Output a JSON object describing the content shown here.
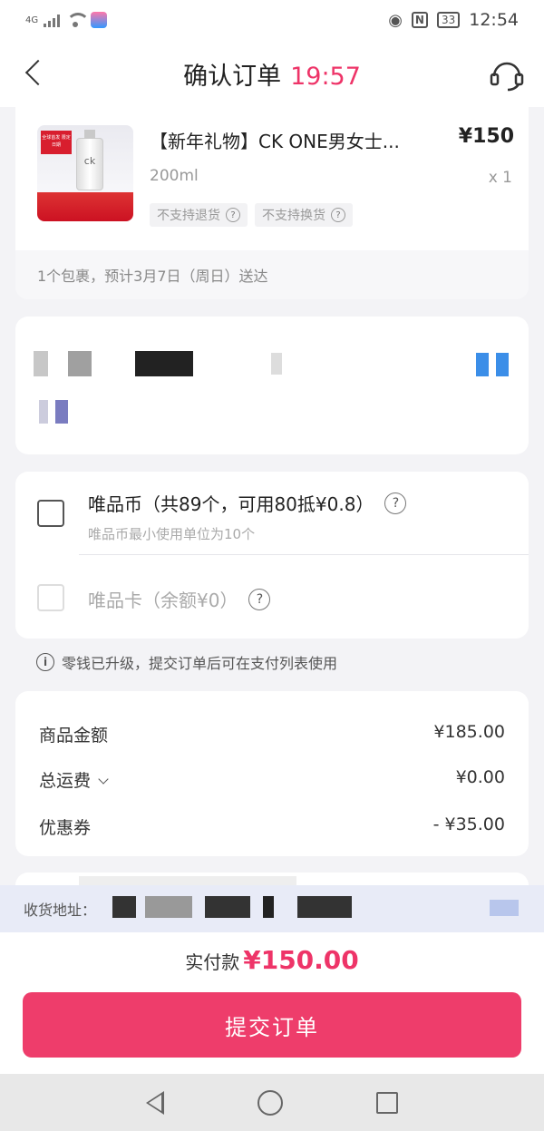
{
  "status_bar": {
    "network": "4G",
    "battery": "33",
    "time": "12:54"
  },
  "header": {
    "title": "确认订单",
    "countdown": "19:57"
  },
  "product": {
    "name": "【新年礼物】CK ONE男女士...",
    "price": "¥150",
    "spec": "200ml",
    "quantity": "x 1",
    "tags": [
      "不支持退货",
      "不支持换货"
    ],
    "thumbnail_text": "ck",
    "thumbnail_badge": "全球首发 限定日期",
    "delivery": "1个包裹，预计3月7日（周日）送达"
  },
  "wallet": {
    "coin_label": "唯品币（共89个，可用80抵¥0.8）",
    "coin_sub": "唯品币最小使用单位为10个",
    "card_label": "唯品卡（余额¥0）",
    "note": "零钱已升级，提交订单后可在支付列表使用"
  },
  "prices": {
    "goods_label": "商品金额",
    "goods_value": "¥185.00",
    "shipping_label": "总运费",
    "shipping_value": "¥0.00",
    "coupon_label": "优惠券",
    "coupon_value": "- ¥35.00"
  },
  "address_bar": {
    "label": "收货地址："
  },
  "bottom": {
    "pay_label": "实付款",
    "pay_amount": "¥150.00",
    "submit_label": "提交订单"
  },
  "colors": {
    "accent": "#ee3d6b",
    "price_red": "#ee3468"
  }
}
